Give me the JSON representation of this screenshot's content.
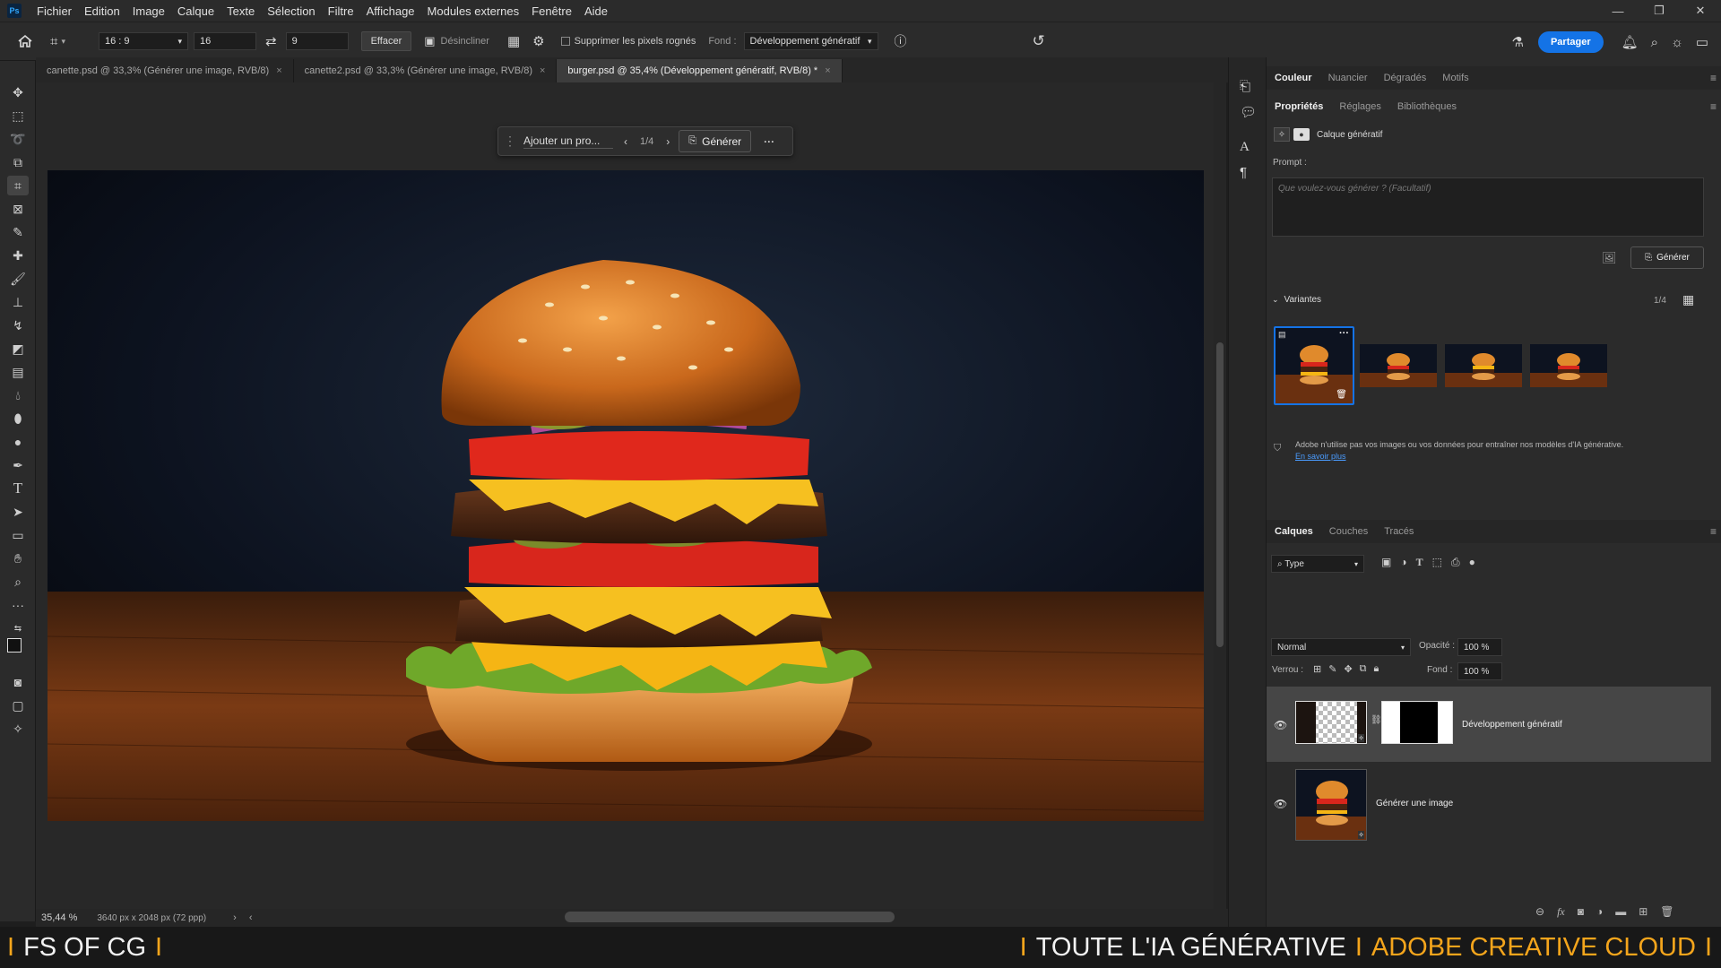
{
  "menubar": {
    "logo": "Ps",
    "items": [
      "Fichier",
      "Edition",
      "Image",
      "Calque",
      "Texte",
      "Sélection",
      "Filtre",
      "Affichage",
      "Modules externes",
      "Fenêtre",
      "Aide"
    ],
    "window_controls": [
      "—",
      "❐",
      "✕"
    ]
  },
  "options": {
    "ratio": "16 : 9",
    "width": "16",
    "height": "9",
    "clear_label": "Effacer",
    "straighten_label": "Désincliner",
    "delete_cropped_label": "Supprimer les pixels rognés",
    "fill_label": "Fond :",
    "fill_value": "Développement génératif",
    "share_label": "Partager"
  },
  "tabs": [
    {
      "label": "canette.psd @ 33,3% (Générer une image, RVB/8)",
      "close": "×"
    },
    {
      "label": "canette2.psd @ 33,3% (Générer une image, RVB/8)",
      "close": "×"
    },
    {
      "label": "burger.psd @ 35,4% (Développement génératif, RVB/8) *",
      "close": "×"
    }
  ],
  "contextbar": {
    "prompt_placeholder": "Ajouter un pro...",
    "counter": "1/4",
    "generate_label": "Générer",
    "more": "···"
  },
  "status": {
    "zoom": "35,44 %",
    "doc_size": "3640 px x 2048 px (72 ppp)"
  },
  "properties_panel": {
    "top_tabs": [
      "Couleur",
      "Nuancier",
      "Dégradés",
      "Motifs"
    ],
    "tabs": [
      "Propriétés",
      "Réglages",
      "Bibliothèques"
    ],
    "layer_type": "Calque génératif",
    "prompt_label": "Prompt :",
    "prompt_placeholder": "Que voulez-vous générer ? (Facultatif)",
    "generate_label": "Générer",
    "variants_label": "Variantes",
    "variants_count": "1/4",
    "notice": "Adobe n'utilise pas vos images ou vos données pour entraîner nos modèles d'IA générative.",
    "learn_more": "En savoir plus"
  },
  "layers_panel": {
    "tabs": [
      "Calques",
      "Couches",
      "Tracés"
    ],
    "filter_label": "Type",
    "blend_mode": "Normal",
    "opacity_label": "Opacité :",
    "opacity_value": "100 %",
    "lock_label": "Verrou :",
    "fill_label": "Fond :",
    "fill_value": "100 %",
    "layers": [
      {
        "name": "Développement génératif"
      },
      {
        "name": "Générer une image"
      }
    ]
  },
  "banner": {
    "left": "FS OF CG",
    "right_white": "TOUTE L'IA GÉNÉRATIVE",
    "right_orange": "ADOBE CREATIVE CLOUD",
    "separator": "I"
  },
  "colors": {
    "accent": "#1473e6",
    "banner_orange": "#f4a51c"
  }
}
